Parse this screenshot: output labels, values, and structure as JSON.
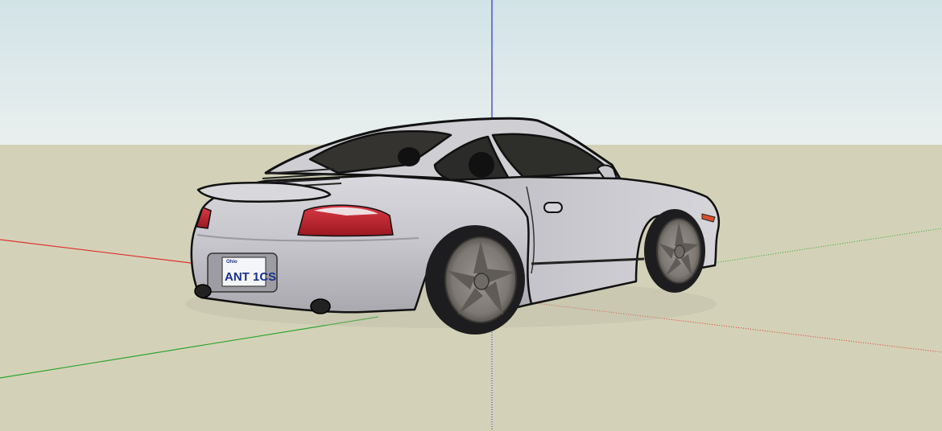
{
  "scene": {
    "sky_top_color": "#d2e3e7",
    "sky_bottom_color": "#e9efee",
    "ground_color": "#d3d2b8",
    "axes": {
      "red": "#e03030",
      "green": "#2fa52f",
      "blue": "#2b2bd6"
    }
  },
  "car": {
    "body_color": "#c6c5cb",
    "glass_color": "#2e2e2b",
    "taillight_color": "#b21e28",
    "wheel_color": "#7d7873",
    "tire_color": "#1d1d1f",
    "license_plate": {
      "text": "ANT 1CS",
      "top_small_text": "Ohio"
    }
  }
}
